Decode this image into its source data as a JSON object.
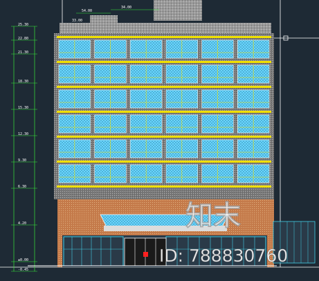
{
  "drawing": {
    "level_labels": [
      "25.30",
      "22.80",
      "21.30",
      "18.30",
      "15.30",
      "12.30",
      "9.30",
      "6.30",
      "4.20",
      "±0.00",
      "-0.45"
    ],
    "top_dimensions": [
      "54.00",
      "33.00",
      "34.00"
    ],
    "colors": {
      "background": "#1e2a35",
      "floor_band": "#f0e000",
      "window_glass": "#6fdcff",
      "facade_hatch": "#8a8a8a",
      "dimension_line": "#38e838",
      "storefront": "#44d0e8",
      "entrance_red": "#ff2020",
      "frame_white": "#ffffff"
    },
    "floors": 6,
    "bays_per_floor": 6
  },
  "watermark": {
    "brand": "知末",
    "id_text": "ID: 788830760"
  }
}
